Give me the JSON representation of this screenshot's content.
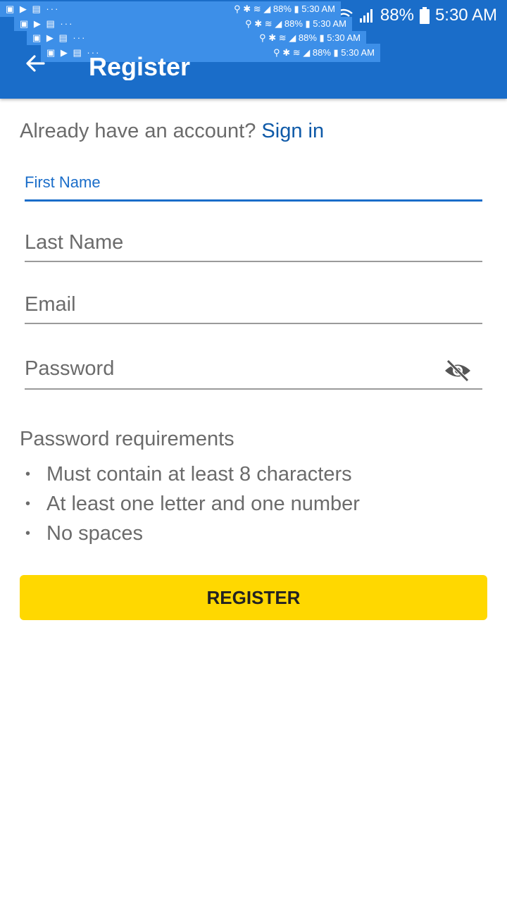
{
  "status_bar": {
    "battery": "88%",
    "time": "5:30 AM",
    "overlay_time": "5:30 AM",
    "overlay_battery": "88%",
    "overlay_dots": "···"
  },
  "app_bar": {
    "title": "Register",
    "color": "#1a6dc9"
  },
  "signin": {
    "prompt": "Already have an account?",
    "link": "Sign in"
  },
  "form": {
    "first_name": {
      "label": "First Name",
      "value": ""
    },
    "last_name": {
      "placeholder": "Last Name"
    },
    "email": {
      "placeholder": "Email"
    },
    "password": {
      "placeholder": "Password",
      "toggle_icon": "eye-off-icon"
    }
  },
  "requirements": {
    "title": "Password requirements",
    "items": [
      "Must contain at least 8 characters",
      "At least one letter and one number",
      "No spaces"
    ]
  },
  "register_button": {
    "label": "REGISTER",
    "color": "#ffd800"
  }
}
